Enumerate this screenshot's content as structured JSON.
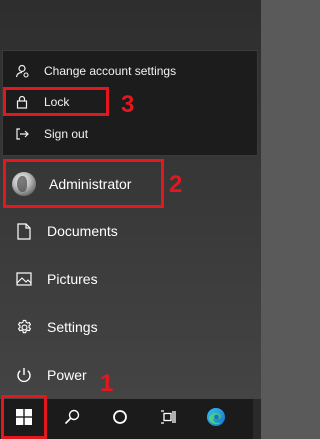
{
  "flyout": {
    "items": [
      {
        "label": "Change account settings",
        "icon": "account-settings-icon"
      },
      {
        "label": "Lock",
        "icon": "lock-icon"
      },
      {
        "label": "Sign out",
        "icon": "sign-out-icon"
      }
    ]
  },
  "left_rail": {
    "user": {
      "label": "Administrator",
      "icon": "avatar"
    },
    "items": [
      {
        "label": "Documents",
        "icon": "document-icon"
      },
      {
        "label": "Pictures",
        "icon": "pictures-icon"
      },
      {
        "label": "Settings",
        "icon": "gear-icon"
      },
      {
        "label": "Power",
        "icon": "power-icon"
      }
    ]
  },
  "taskbar": {
    "buttons": [
      "windows-start-icon",
      "search-icon",
      "cortana-icon",
      "task-view-icon",
      "edge-icon"
    ]
  },
  "annotations": {
    "step1": "1",
    "step2": "2",
    "step3": "3",
    "highlight_color": "#e3171e"
  }
}
